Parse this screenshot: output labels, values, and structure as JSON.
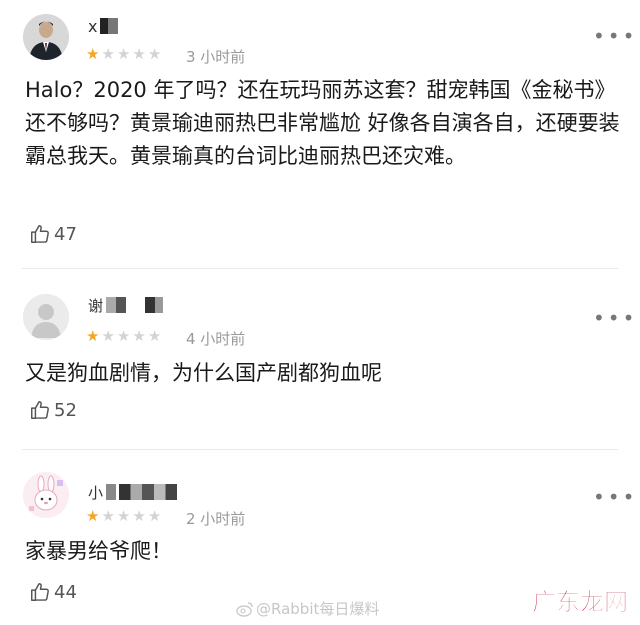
{
  "comments": [
    {
      "username": "x",
      "rating": 1,
      "max_rating": 5,
      "time": "3 小时前",
      "text": "Halo？2020 年了吗？还在玩玛丽苏这套？甜宠韩国《金秘书》还不够吗？黄景瑜迪丽热巴非常尴尬 好像各自演各自，还硬要装霸总我天。黄景瑜真的台词比迪丽热巴还灾难。",
      "likes": "47"
    },
    {
      "username": "谢",
      "rating": 1,
      "max_rating": 5,
      "time": "4 小时前",
      "text": "又是狗血剧情，为什么国产剧都狗血呢",
      "likes": "52"
    },
    {
      "username": "小",
      "rating": 1,
      "max_rating": 5,
      "time": "2 小时前",
      "text": "家暴男给爷爬！",
      "likes": "44"
    }
  ],
  "more_glyph": "•••",
  "footer": {
    "watermark_text": "@Rabbit每日爆料"
  },
  "corner_logo": {
    "text": "广东龙网",
    "color": "#b8001c"
  },
  "icons": {
    "avatar_1": "man-in-suit-avatar",
    "avatar_2": "default-grey-avatar",
    "avatar_3": "bunny-sticker-avatar",
    "like": "thumbs-up-icon",
    "more": "more-dots-icon",
    "weibo": "weibo-icon"
  },
  "colors": {
    "star_on": "#f5a623",
    "star_off": "#d3d3d3"
  }
}
